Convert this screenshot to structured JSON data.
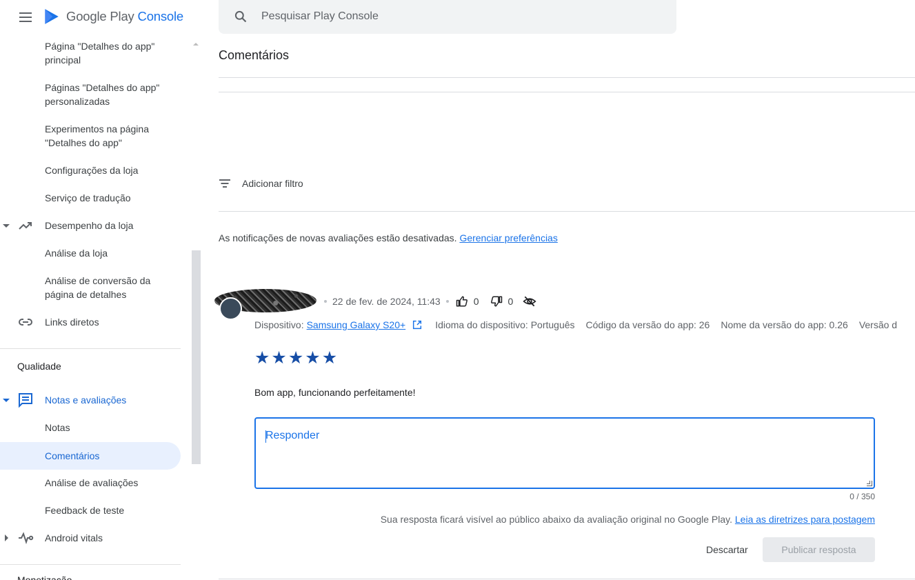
{
  "app": {
    "logo_primary": "Google Play",
    "logo_secondary": "Console"
  },
  "search": {
    "placeholder": "Pesquisar Play Console"
  },
  "sidebar": {
    "items": [
      {
        "label": "Página \"Detalhes do app\" principal"
      },
      {
        "label": "Páginas \"Detalhes do app\" personalizadas"
      },
      {
        "label": "Experimentos na página \"Detalhes do app\""
      },
      {
        "label": "Configurações da loja"
      },
      {
        "label": "Serviço de tradução"
      },
      {
        "label": "Desempenho da loja"
      },
      {
        "label": "Análise da loja"
      },
      {
        "label": "Análise de conversão da página de detalhes"
      },
      {
        "label": "Links diretos"
      }
    ],
    "quality_section": "Qualidade",
    "quality_items": [
      {
        "label": "Notas e avaliações"
      },
      {
        "label": "Notas"
      },
      {
        "label": "Comentários"
      },
      {
        "label": "Análise de avaliações"
      },
      {
        "label": "Feedback de teste"
      },
      {
        "label": "Android vitals"
      }
    ],
    "bottom_partial": "Monetização"
  },
  "main": {
    "title": "Comentários",
    "add_filter": "Adicionar filtro",
    "notice_text": "As notificações de novas avaliações estão desativadas.",
    "notice_link": "Gerenciar preferências"
  },
  "review": {
    "date": "22 de fev. de 2024, 11:43",
    "likes": "0",
    "dislikes": "0",
    "device_label": "Dispositivo:",
    "device_value": "Samsung Galaxy S20+",
    "language": "Idioma do dispositivo: Português",
    "version_code": "Código da versão do app: 26",
    "version_name": "Nome da versão do app: 0.26",
    "version_cut": "Versão d",
    "rating": 5,
    "stars": "★★★★★",
    "text": "Bom app, funcionando perfeitamente!"
  },
  "reply": {
    "placeholder": "Responder",
    "counter": "0 / 350",
    "guideline_text": "Sua resposta ficará visível ao público abaixo da avaliação original no Google Play.",
    "guideline_link": "Leia as diretrizes para postagem",
    "discard_label": "Descartar",
    "publish_label": "Publicar resposta"
  },
  "colors": {
    "accent": "#1a73e8",
    "active_nav_bg": "#e8f0fe",
    "star": "#174ea6"
  }
}
